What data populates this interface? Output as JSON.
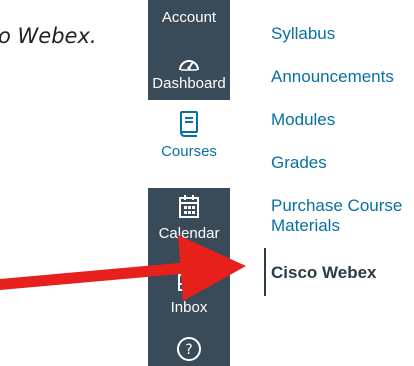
{
  "instruction_fragment": "o Webex.",
  "global_nav": {
    "items": [
      {
        "label": "Account",
        "icon": "account-icon"
      },
      {
        "label": "Dashboard",
        "icon": "dashboard-gauge-icon"
      },
      {
        "label": "Courses",
        "icon": "book-icon",
        "active": true
      },
      {
        "label": "Calendar",
        "icon": "calendar-icon"
      },
      {
        "label": "Inbox",
        "icon": "inbox-icon"
      },
      {
        "label": "",
        "icon": "help-icon"
      }
    ],
    "colors": {
      "background": "#394B58",
      "active_background": "#FFFFFF",
      "active_text": "#0770A3"
    }
  },
  "course_nav": {
    "links": [
      {
        "label": "Syllabus"
      },
      {
        "label": "Announcements"
      },
      {
        "label": "Modules"
      },
      {
        "label": "Grades"
      },
      {
        "label": "Purchase Course Materials"
      },
      {
        "label": "Cisco Webex",
        "current": true
      }
    ],
    "colors": {
      "link": "#0770A3",
      "current": "#2D3B45"
    }
  },
  "annotation": {
    "type": "arrow",
    "color": "#E8201B",
    "points_to": "Cisco Webex"
  }
}
